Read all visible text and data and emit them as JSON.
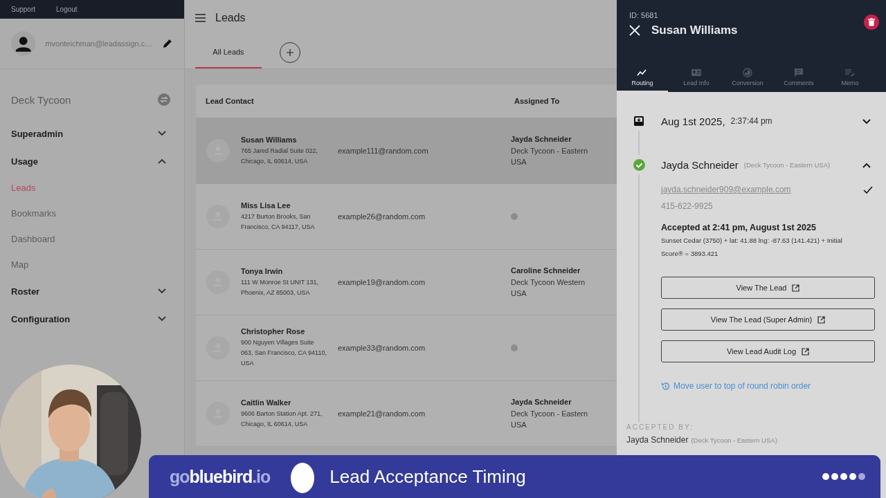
{
  "top_links": [
    "Support",
    "Logout"
  ],
  "user": {
    "email": "mvonteichman@leadassign.c…"
  },
  "sidebar": {
    "company": "Deck Tycoon",
    "items": [
      {
        "kind": "group",
        "label": "Superadmin",
        "expanded": false
      },
      {
        "kind": "group",
        "label": "Usage",
        "expanded": true
      },
      {
        "kind": "link",
        "label": "Leads",
        "selected": true
      },
      {
        "kind": "link",
        "label": "Bookmarks",
        "selected": false
      },
      {
        "kind": "link",
        "label": "Dashboard",
        "selected": false
      },
      {
        "kind": "link",
        "label": "Map",
        "selected": false
      },
      {
        "kind": "group",
        "label": "Roster",
        "expanded": false
      },
      {
        "kind": "group",
        "label": "Configuration",
        "expanded": false
      }
    ]
  },
  "header": {
    "title": "Leads",
    "tabs": [
      {
        "label": "All Leads",
        "selected": true
      }
    ]
  },
  "table": {
    "columns": [
      "Lead Contact",
      "Assigned To"
    ],
    "rows": [
      {
        "name": "Susan Williams",
        "address": "765 Jared Radial Suite 022, Chicago, IL 60614, USA",
        "email": "example111@random.com",
        "assigned": true,
        "assignee": "Jayda Schneider",
        "team": "Deck Tycoon - Eastern USA",
        "selected": true
      },
      {
        "name": "Miss Lisa Lee",
        "address": "4217 Burton Brooks, San Francisco, CA 94117, USA",
        "email": "example26@random.com",
        "assigned": false,
        "selected": false
      },
      {
        "name": "Tonya Irwin",
        "address": "111 W Monroe St UNIT 131, Phoenix, AZ 85003, USA",
        "email": "example19@random.com",
        "assigned": true,
        "assignee": "Caroline Schneider",
        "team": "Deck Tycoon Western USA",
        "selected": false
      },
      {
        "name": "Christopher Rose",
        "address": "900 Nguyen Villages Suite 063, San Francisco, CA 94110, USA",
        "email": "example33@random.com",
        "assigned": false,
        "selected": false
      },
      {
        "name": "Caitlin Walker",
        "address": "9606 Barton Station Apt. 271, Chicago, IL 60614, USA",
        "email": "example21@random.com",
        "assigned": true,
        "assignee": "Jayda Schneider",
        "team": "Deck Tycoon - Eastern USA",
        "selected": false
      }
    ]
  },
  "panel": {
    "id": "ID: 5681",
    "title": "Susan Williams",
    "tabs": [
      {
        "label": "Routing",
        "selected": true
      },
      {
        "label": "Lead Info",
        "selected": false
      },
      {
        "label": "Conversion",
        "selected": false
      },
      {
        "label": "Comments",
        "selected": false
      },
      {
        "label": "Memo",
        "selected": false
      }
    ],
    "timeline": [
      {
        "kind": "created",
        "date": "Aug 1st 2025,",
        "time": "2:37:44 pm",
        "expanded": false
      },
      {
        "kind": "assignment",
        "name": "Jayda Schneider",
        "team": "(Deck Tycoon - Eastern USA)",
        "expanded": true,
        "accepted": true,
        "email": "jayda.schneider909@example.com",
        "email_verified": true,
        "phone": "415-622-9925",
        "accepted_text": "Accepted at 2:41 pm, August 1st 2025",
        "score": "Sunset Cedar (3750) + lat: 41.88 lng: -87.63 (141.421) + Initial Score® = 3893.421",
        "buttons": [
          "View The Lead",
          "View The Lead (Super Admin)",
          "View Lead Audit Log"
        ],
        "action": "Move user to top of round robin order"
      }
    ],
    "accepted_by": {
      "label": "ACCEPTED BY:",
      "name": "Jayda Schneider",
      "team": "(Deck Tycoon - Eastern USA)"
    }
  },
  "banner": {
    "logo_parts": [
      {
        "text": "go",
        "color": "#a9b0e4"
      },
      {
        "text": "bluebird",
        "color": "#ffffff"
      },
      {
        "text": ".io",
        "color": "#a9b0e4"
      }
    ],
    "title": "Lead Acceptance Timing",
    "steps": [
      {
        "done": true
      },
      {
        "done": true
      },
      {
        "done": true
      },
      {
        "done": true
      },
      {
        "done": false
      }
    ]
  },
  "webcam": {
    "kind": "picture"
  }
}
